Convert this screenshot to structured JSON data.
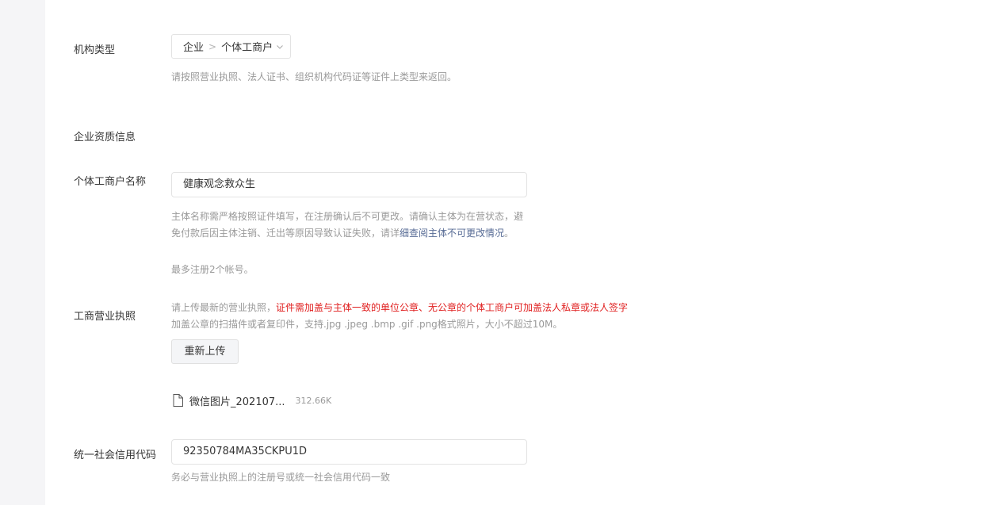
{
  "org_type": {
    "label": "机构类型",
    "select_primary": "企业",
    "select_separator": ">",
    "select_secondary": "个体工商户",
    "hint": "请按照营业执照、法人证书、组织机构代码证等证件上类型来返回。"
  },
  "qualification": {
    "section_title": "企业资质信息"
  },
  "business_name": {
    "label": "个体工商户名称",
    "value": "健康观念救众生",
    "notice_part1": "主体名称需严格按照证件填写，在注册确认后不可更改。请确认主体为在营状态，避免付款后因主体注销、迁出等原因导致认证失败，请详",
    "notice_link": "细查阅主体不可更改情况",
    "notice_part2": "。",
    "limit": "最多注册2个帐号。"
  },
  "license": {
    "label": "工商营业执照",
    "instruction_prefix": "请上传最新的营业执照，",
    "instruction_warning": "证件需加盖与主体一致的单位公章、无公章的个体工商户可加盖法人私章或法人签字",
    "format_hint": "加盖公章的扫描件或者复印件，支持.jpg .jpeg .bmp .gif .png格式照片，大小不超过10M。",
    "reupload_button": "重新上传",
    "file_name": "微信图片_202107...",
    "file_size": "312.66K",
    "file_icon": "document-icon"
  },
  "credit_code": {
    "label": "统一社会信用代码",
    "value": "92350784MA35CKPU1D",
    "hint": "务必与营业执照上的注册号或统一社会信用代码一致"
  },
  "colors": {
    "warning": "#e02020",
    "link": "#576b95",
    "hint": "#9a9a9a"
  }
}
